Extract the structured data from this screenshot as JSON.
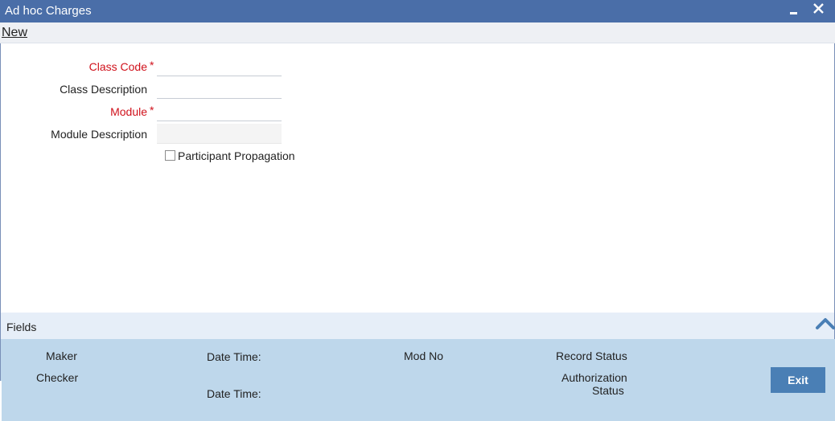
{
  "window": {
    "title": "Ad hoc Charges",
    "minimize_icon": "minimize-icon",
    "close_icon": "close-icon"
  },
  "menu": {
    "new_label": "New"
  },
  "form": {
    "class_code_label": "Class Code",
    "class_code_value": "",
    "class_description_label": "Class Description",
    "class_description_value": "",
    "module_label": "Module",
    "module_value": "",
    "module_description_label": "Module Description",
    "module_description_value": "",
    "required_marker": "*",
    "participant_propagation_label": "Participant Propagation",
    "participant_propagation_checked": false
  },
  "fields_bar": {
    "label": "Fields",
    "toggle_icon": "chevron-up-icon"
  },
  "audit": {
    "maker_label": "Maker",
    "checker_label": "Checker",
    "date_time_label_1": "Date Time:",
    "date_time_label_2": "Date Time:",
    "mod_no_label": "Mod No",
    "record_status_label": "Record Status",
    "authorization_label_line1": "Authorization",
    "authorization_label_line2": "Status",
    "exit_label": "Exit"
  },
  "colors": {
    "title_bar": "#4a6ea8",
    "required_label": "#d0111b",
    "audit_panel": "#bed7eb",
    "exit_button": "#4a7fb5"
  }
}
